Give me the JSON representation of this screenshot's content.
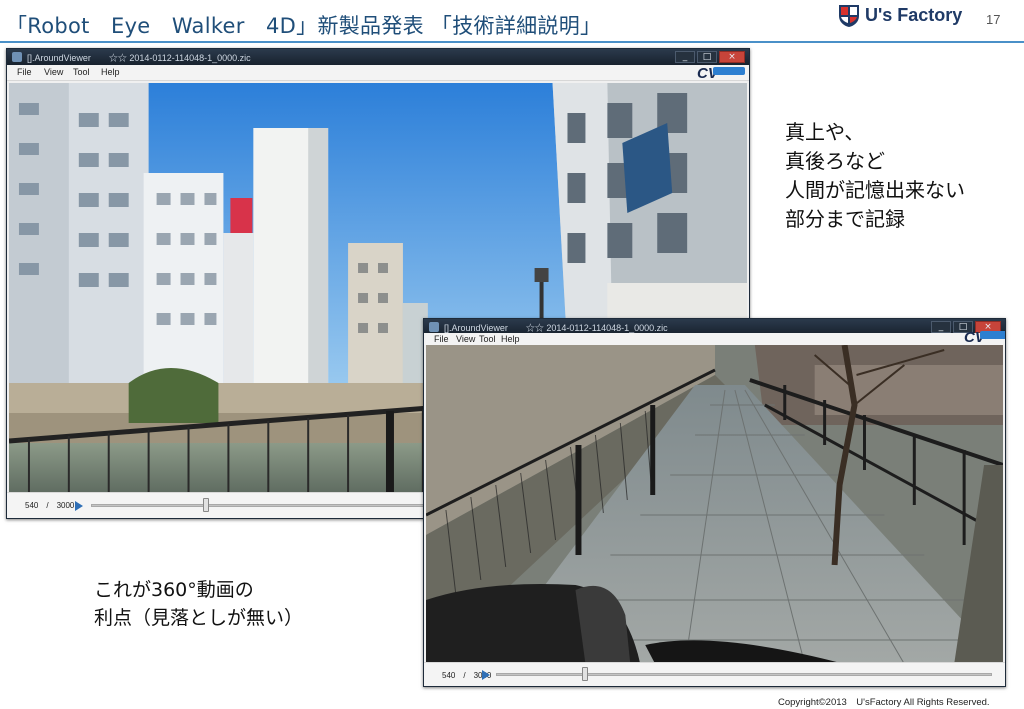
{
  "slide": {
    "title": "「Robot　Eye　Walker　4D」新製品発表 「技術詳細説明」",
    "logo_text": "U's Factory",
    "page_number": "17",
    "copyright": "Copyright©2013　U'sFactory All Rights Reserved.",
    "accent_color": "#1f4e79"
  },
  "captions": {
    "right": [
      "真上や、",
      "真後ろなど",
      "人間が記憶出来ない",
      "部分まで記録"
    ],
    "left": [
      "これが360°動画の",
      "利点（見落としが無い）"
    ]
  },
  "viewer_back": {
    "window_title": "[].AroundViewer　　☆☆ 2014-0112-114048-1_0000.zic",
    "menu": [
      "File",
      "View",
      "Tool",
      "Help"
    ],
    "cv_logo": "CV",
    "window_buttons": [
      "_",
      "□",
      "×"
    ],
    "frame_counter": "540　/　3000",
    "progress": 0.18
  },
  "viewer_front": {
    "window_title": "[].AroundViewer　　☆☆ 2014-0112-114048-1_0000.zic",
    "menu": [
      "File",
      "View",
      "Tool",
      "Help"
    ],
    "cv_logo": "CV",
    "window_buttons": [
      "_",
      "□",
      "×"
    ],
    "frame_counter": "540　/　3000",
    "progress": 0.18
  },
  "icons": {
    "play": "play-icon",
    "logo": "us-factory-logo-icon"
  }
}
